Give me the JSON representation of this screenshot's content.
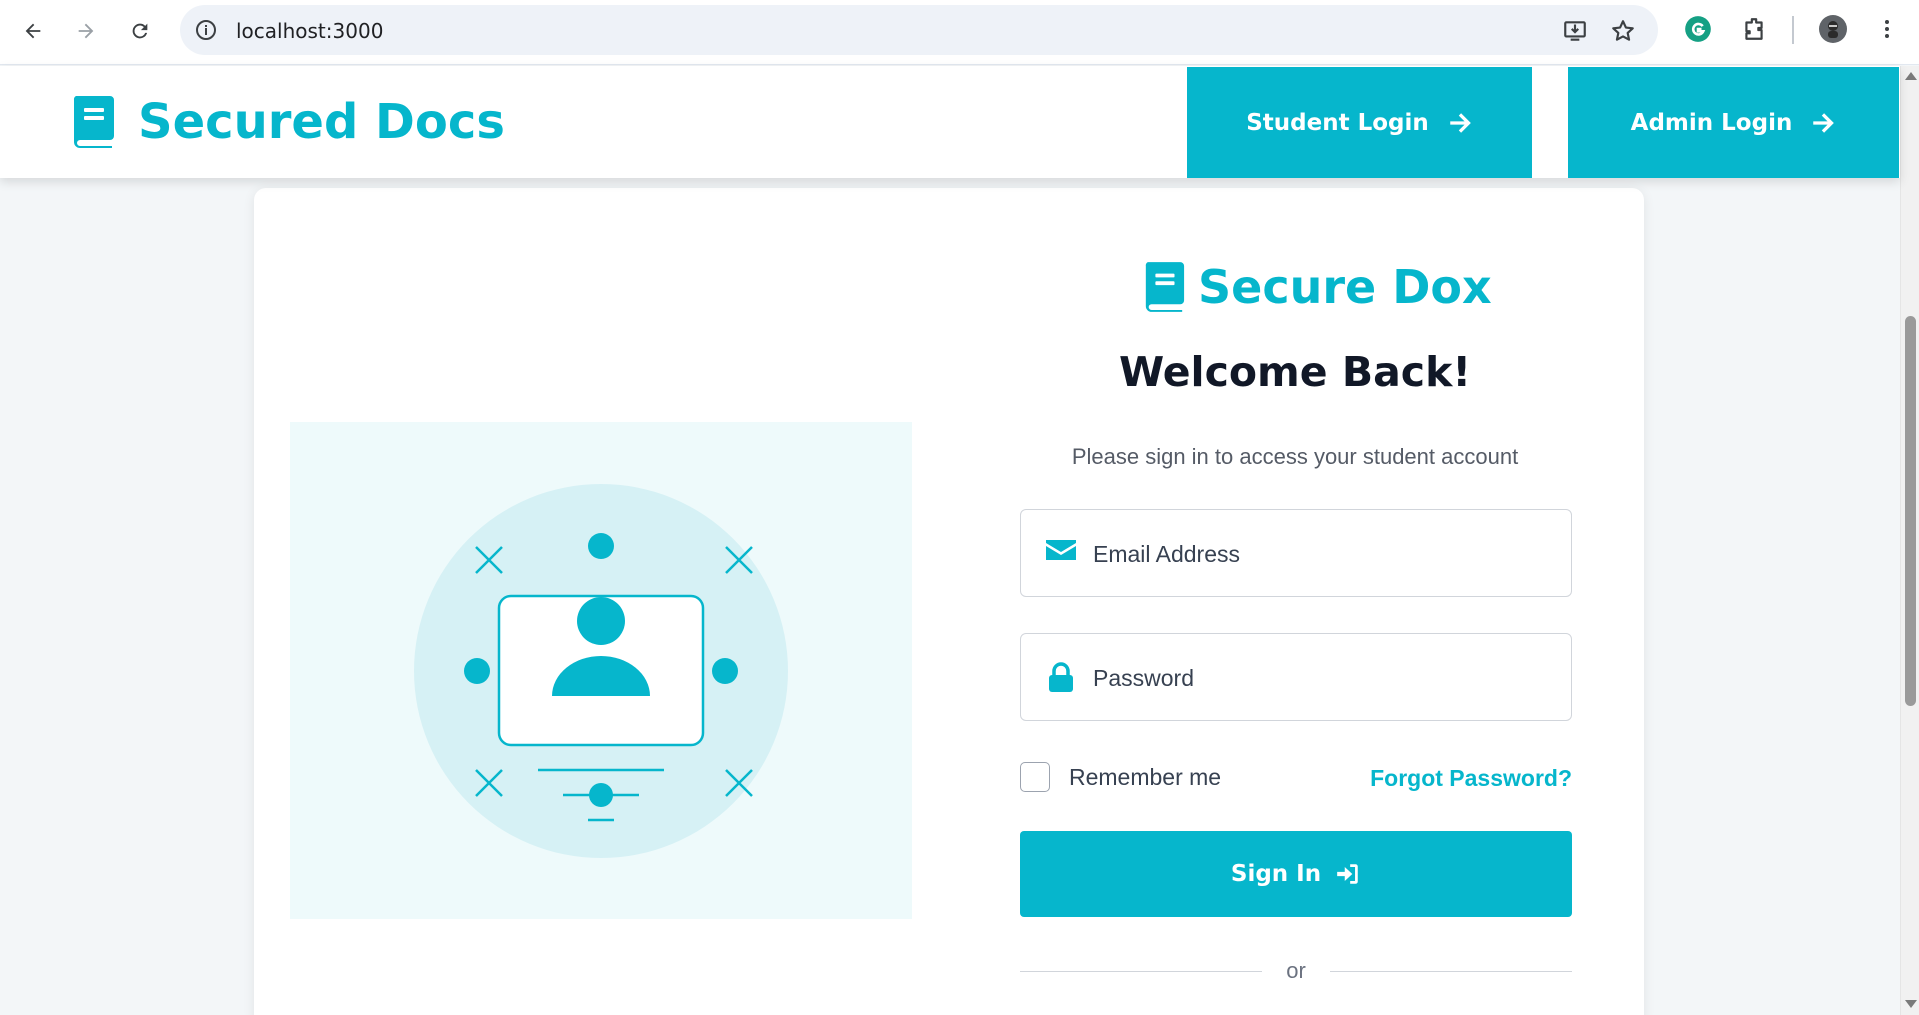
{
  "browser": {
    "url": "localhost:3000",
    "icons": [
      "back-arrow-icon",
      "forward-arrow-icon",
      "reload-icon",
      "site-info-icon",
      "install-app-icon",
      "bookmark-star-icon",
      "grammarly-icon",
      "extensions-icon",
      "profile-avatar",
      "more-menu-icon"
    ]
  },
  "header": {
    "brand": "Secured Docs",
    "student_login": "Student Login",
    "admin_login": "Admin Login"
  },
  "login": {
    "logo_text": "Secure Dox",
    "title": "Welcome Back!",
    "subtitle": "Please sign in to access your student account",
    "email_placeholder": "Email Address",
    "password_placeholder": "Password",
    "remember_label": "Remember me",
    "forgot_link": "Forgot Password?",
    "signin_label": "Sign In",
    "divider_text": "or"
  },
  "colors": {
    "accent": "#06b6cc",
    "page_bg": "#f3f6f8",
    "illustration_bg": "#eefafb",
    "heading": "#111827"
  }
}
